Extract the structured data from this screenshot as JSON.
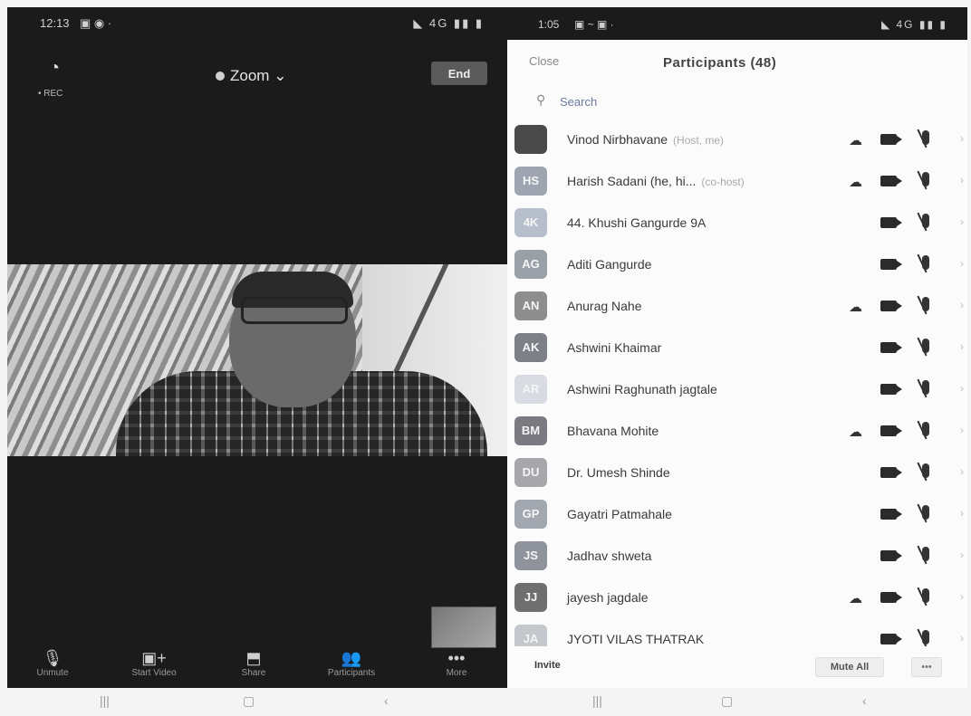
{
  "left_phone": {
    "status_time": "12:13",
    "status_icons": "▣ ◉ ·",
    "status_right": "◣ 4G ▮▮ ▮",
    "rec_label": "• REC",
    "meeting_title": "Zoom",
    "end_label": "End",
    "toolbar": [
      {
        "icon": "mic-off-icon",
        "glyph": "🎙",
        "label": "Unmute"
      },
      {
        "icon": "video-off-icon",
        "glyph": "▣+",
        "label": "Start Video"
      },
      {
        "icon": "share-icon",
        "glyph": "⬒",
        "label": "Share"
      },
      {
        "icon": "participants-icon",
        "glyph": "👥",
        "label": "Participants"
      },
      {
        "icon": "more-icon",
        "glyph": "•••",
        "label": "More"
      }
    ]
  },
  "right_phone": {
    "status_time": "1:05",
    "status_icons": "▣ ~ ▣ ·",
    "status_right": "◣ 4G ▮▮ ▮",
    "close_label": "Close",
    "title": "Participants (48)",
    "search_placeholder": "Search",
    "participants": [
      {
        "initials": "",
        "name": "Vinod Nirbhavane",
        "tag": "(Host, me)",
        "raise": true,
        "color": "#4a4a4a"
      },
      {
        "initials": "HS",
        "name": "Harish Sadani (he, hi...",
        "tag": "(co-host)",
        "raise": true,
        "color": "#9ea5b0"
      },
      {
        "initials": "4K",
        "name": "44. Khushi Gangurde 9A",
        "tag": "",
        "raise": false,
        "color": "#b8bfcc"
      },
      {
        "initials": "AG",
        "name": "Aditi Gangurde",
        "tag": "",
        "raise": false,
        "color": "#9aa0a8"
      },
      {
        "initials": "AN",
        "name": "Anurag Nahe",
        "tag": "",
        "raise": true,
        "color": "#8e8e8e"
      },
      {
        "initials": "AK",
        "name": "Ashwini Khaimar",
        "tag": "",
        "raise": false,
        "color": "#7e8088"
      },
      {
        "initials": "AR",
        "name": "Ashwini Raghunath jagtale",
        "tag": "",
        "raise": false,
        "color": "#d8dbe2"
      },
      {
        "initials": "BM",
        "name": "Bhavana Mohite",
        "tag": "",
        "raise": true,
        "color": "#7a7a80"
      },
      {
        "initials": "DU",
        "name": "Dr. Umesh Shinde",
        "tag": "",
        "raise": false,
        "color": "#a7a7ab"
      },
      {
        "initials": "GP",
        "name": "Gayatri Patmahale",
        "tag": "",
        "raise": false,
        "color": "#a2a7b0"
      },
      {
        "initials": "JS",
        "name": "Jadhav shweta",
        "tag": "",
        "raise": false,
        "color": "#8f949c"
      },
      {
        "initials": "JJ",
        "name": "jayesh jagdale",
        "tag": "",
        "raise": true,
        "color": "#6f6f6f"
      },
      {
        "initials": "JA",
        "name": "JYOTI VILAS THATRAK",
        "tag": "",
        "raise": false,
        "color": "#c4c7cc"
      }
    ],
    "invite_label": "Invite",
    "mute_all_label": "Mute All",
    "more_label": "•••"
  },
  "system_nav": {
    "recents": "|||",
    "home": "▢",
    "back": "‹"
  }
}
